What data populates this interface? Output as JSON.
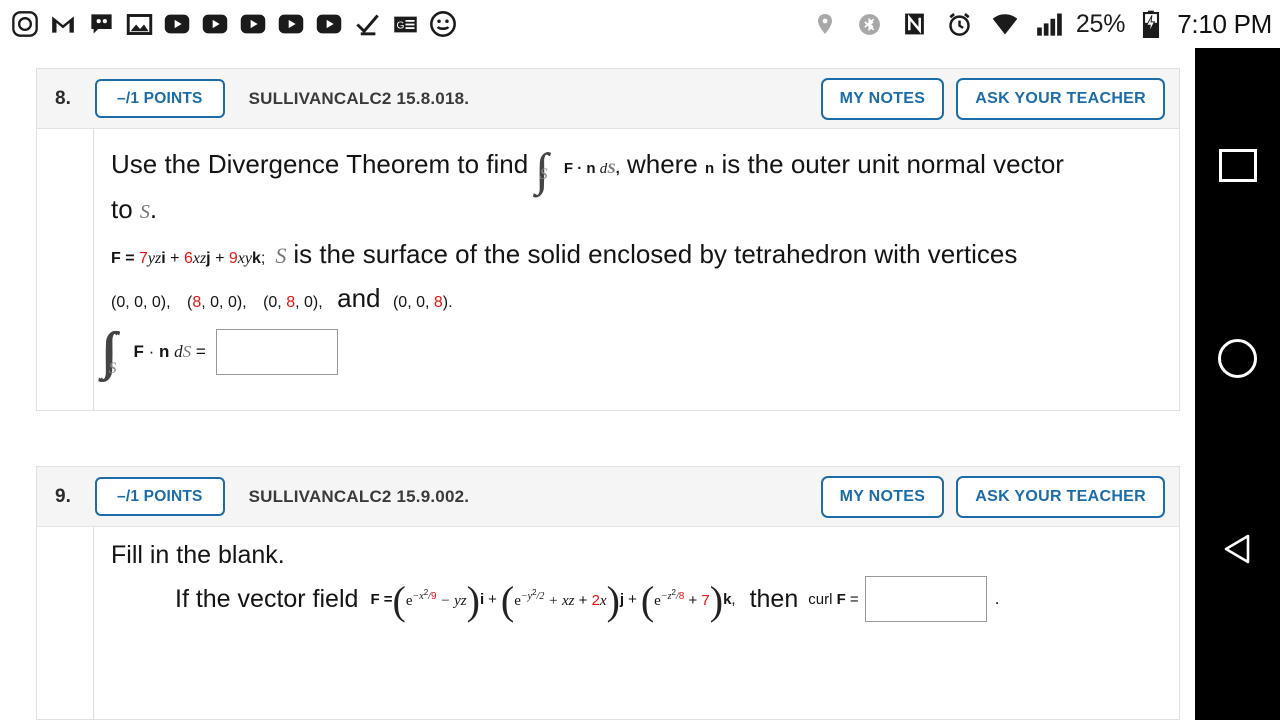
{
  "statusbar": {
    "left_icons": [
      "instagram-icon",
      "gmail-icon",
      "voicemail-icon",
      "photos-icon",
      "youtube-icon",
      "youtube-icon",
      "youtube-icon",
      "youtube-icon",
      "youtube-icon",
      "checkmark-icon",
      "google-news-icon",
      "smiley-icon"
    ],
    "right_icons": [
      "location-icon",
      "bluetooth-icon",
      "nfc-icon",
      "alarm-icon",
      "wifi-icon",
      "signal-icon"
    ],
    "battery_percent": "25%",
    "battery_icon": "battery-charging-icon",
    "time": "7:10 PM"
  },
  "navbar": {
    "recents_label": "recents-square",
    "home_label": "home-circle",
    "back_label": "back-triangle"
  },
  "questions": [
    {
      "number": "8.",
      "points": "–/1 POINTS",
      "code": "SULLIVANCALC2 15.8.018.",
      "my_notes": "MY NOTES",
      "ask_teacher": "ASK YOUR TEACHER",
      "prompt_a": "Use the Divergence Theorem to find",
      "integral_sub": "S",
      "integrand": "F · n dS,",
      "prompt_b": "where",
      "normal_symbol": "n",
      "prompt_c": "is the outer unit normal vector",
      "prompt_d": "to",
      "surface_symbol": "S",
      "prompt_d_end": ".",
      "field_label": "F =",
      "field_terms": [
        {
          "coef": "7",
          "rest": "yz",
          "unit": "i"
        },
        {
          "coef": "6",
          "rest": "xz",
          "unit": "j"
        },
        {
          "coef": "9",
          "rest": "xy",
          "unit": "k"
        }
      ],
      "field_tail": ";",
      "surface_sentence": "is the surface of the solid enclosed by tetrahedron with vertices",
      "vertices": [
        {
          "text": "(0, 0, 0),",
          "red_index": -1
        },
        {
          "text": "(8, 0, 0),",
          "red_index": 1
        },
        {
          "text": "(0, 8, 0),",
          "red_index": 4
        },
        {
          "text": "(0, 0, 8).",
          "red_index": 7
        }
      ],
      "vertices_and": "and",
      "answer_label": "F · n dS =",
      "answer_value": "",
      "answer_sub": "S"
    },
    {
      "number": "9.",
      "points": "–/1 POINTS",
      "code": "SULLIVANCALC2 15.9.002.",
      "my_notes": "MY NOTES",
      "ask_teacher": "ASK YOUR TEACHER",
      "prompt_a": "Fill in the blank.",
      "prompt_b": "If the vector field",
      "field_label": "F =",
      "field_parts": {
        "i_term": {
          "exp_base": "e",
          "exp": "−x²/9",
          "exp_red": "9",
          "rest": " − yz",
          "unit": "i"
        },
        "j_term": {
          "exp_base": "e",
          "exp": "−y²/2",
          "rest": " + xz + ",
          "red": "2",
          "red_rest": "x",
          "unit": "j"
        },
        "k_term": {
          "exp_base": "e",
          "exp": "−z²/8",
          "exp_red": "8",
          "rest": " + ",
          "red": "7",
          "unit": "k"
        }
      },
      "field_tail": ",",
      "then_label": "then",
      "curl_label": "curl F =",
      "answer_value": "",
      "period": "."
    }
  ],
  "colors": {
    "accent_blue": "#1b6ca8",
    "red_value": "#ee1111",
    "header_bg": "#f5f5f5",
    "card_border": "#e0e0e0",
    "navbar_bg": "#000000"
  }
}
